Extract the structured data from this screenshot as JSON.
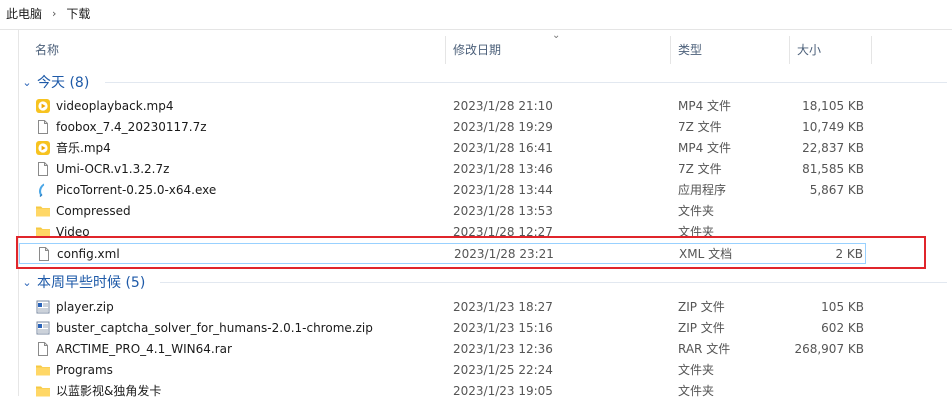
{
  "breadcrumb": {
    "root": "此电脑",
    "current": "下载"
  },
  "columns": {
    "name": "名称",
    "date": "修改日期",
    "type": "类型",
    "size": "大小"
  },
  "groups": [
    {
      "title": "今天 (8)"
    },
    {
      "title": "本周早些时候 (5)"
    }
  ],
  "today": [
    {
      "name": "videoplayback.mp4",
      "date": "2023/1/28 21:10",
      "type": "MP4 文件",
      "size": "18,105 KB",
      "icon": "media-file-icon"
    },
    {
      "name": "foobox_7.4_20230117.7z",
      "date": "2023/1/28 19:29",
      "type": "7Z 文件",
      "size": "10,749 KB",
      "icon": "file-icon"
    },
    {
      "name": "音乐.mp4",
      "date": "2023/1/28 16:41",
      "type": "MP4 文件",
      "size": "22,837 KB",
      "icon": "media-file-icon"
    },
    {
      "name": "Umi-OCR.v1.3.2.7z",
      "date": "2023/1/28 13:46",
      "type": "7Z 文件",
      "size": "81,585 KB",
      "icon": "file-icon"
    },
    {
      "name": "PicoTorrent-0.25.0-x64.exe",
      "date": "2023/1/28 13:44",
      "type": "应用程序",
      "size": "5,867 KB",
      "icon": "app-icon"
    },
    {
      "name": "Compressed",
      "date": "2023/1/28 13:53",
      "type": "文件夹",
      "size": "",
      "icon": "folder-icon"
    },
    {
      "name": "Video",
      "date": "2023/1/28 12:27",
      "type": "文件夹",
      "size": "",
      "icon": "folder-icon"
    },
    {
      "name": "config.xml",
      "date": "2023/1/28 23:21",
      "type": "XML 文档",
      "size": "2 KB",
      "icon": "file-icon"
    }
  ],
  "earlier": [
    {
      "name": "player.zip",
      "date": "2023/1/23 18:27",
      "type": "ZIP 文件",
      "size": "105 KB",
      "icon": "zip-icon"
    },
    {
      "name": "buster_captcha_solver_for_humans-2.0.1-chrome.zip",
      "date": "2023/1/23 15:16",
      "type": "ZIP 文件",
      "size": "602 KB",
      "icon": "zip-icon"
    },
    {
      "name": "ARCTIME_PRO_4.1_WIN64.rar",
      "date": "2023/1/23 12:36",
      "type": "RAR 文件",
      "size": "268,907 KB",
      "icon": "file-icon"
    },
    {
      "name": "Programs",
      "date": "2023/1/25 22:24",
      "type": "文件夹",
      "size": "",
      "icon": "folder-icon"
    },
    {
      "name": "以蓝影视&独角发卡",
      "date": "2023/1/23 19:05",
      "type": "文件夹",
      "size": "",
      "icon": "folder-icon"
    }
  ],
  "colors": {
    "accent": "#1e5aa8",
    "highlight": "#e0252b",
    "selection": "#99d1ff"
  }
}
